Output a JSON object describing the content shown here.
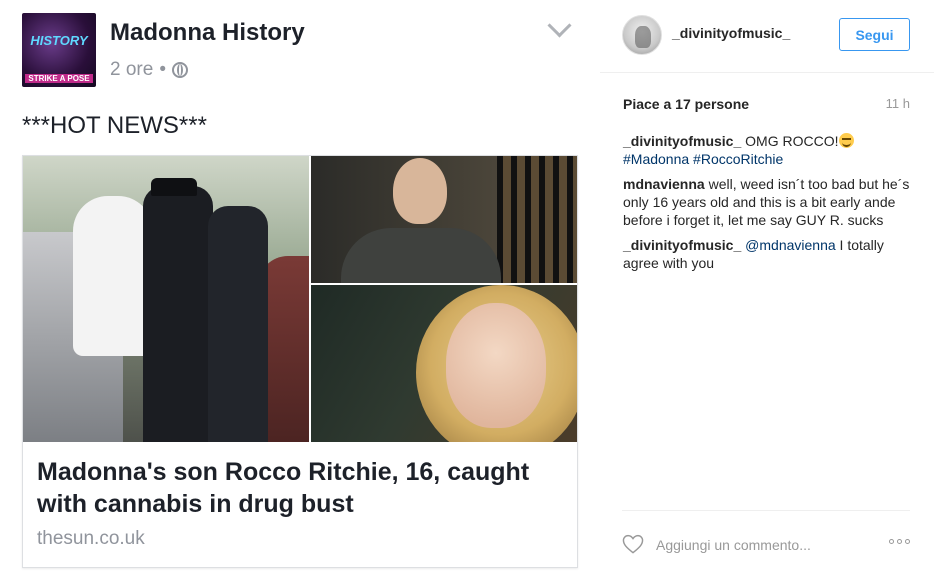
{
  "facebook_post": {
    "avatar_text_top": "HISTORY",
    "avatar_text_bottom": "STRIKE A POSE",
    "page_name": "Madonna History",
    "time": "2 ore",
    "text": "***HOT NEWS***",
    "link_title": "Madonna's son Rocco Ritchie, 16, caught with cannabis in drug bust",
    "link_domain": "thesun.co.uk"
  },
  "header": {
    "username": "_divinityofmusic_",
    "follow_label": "Segui"
  },
  "stats": {
    "likes": "Piace a 17 persone",
    "time": "11 h"
  },
  "comments": [
    {
      "user": "_divinityofmusic_",
      "text": "OMG ROCCO!",
      "tags": "#Madonna #RoccoRitchie"
    },
    {
      "user": "mdnavienna",
      "text": "well, weed isn´t too bad but he´s only 16 years old and this is a bit early ande before i forget it, let me say GUY R. sucks"
    },
    {
      "user": "_divinityofmusic_",
      "mention": "@mdnavienna",
      "text": "I totally agree with you"
    }
  ],
  "footer": {
    "comment_placeholder": "Aggiungi un commento..."
  },
  "colors": {
    "accent": "#3897f0",
    "hashtag": "#003569",
    "muted": "#999999"
  },
  "icons": [
    "heart-icon",
    "more-options-icon",
    "globe-icon",
    "chevron-down-icon"
  ]
}
